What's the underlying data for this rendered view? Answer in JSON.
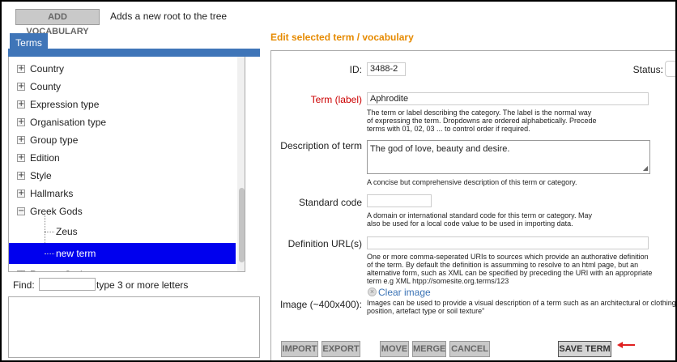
{
  "toolbar": {
    "add_vocab_label": "ADD VOCABULARY",
    "add_vocab_hint": "Adds a new root to the tree"
  },
  "tree": {
    "tab_label": "Terms",
    "items": [
      {
        "label": "Country",
        "toggle": "+"
      },
      {
        "label": "County",
        "toggle": "+"
      },
      {
        "label": "Expression type",
        "toggle": "+"
      },
      {
        "label": "Organisation type",
        "toggle": "+"
      },
      {
        "label": "Group type",
        "toggle": "+"
      },
      {
        "label": "Edition",
        "toggle": "+"
      },
      {
        "label": "Style",
        "toggle": "+"
      },
      {
        "label": "Hallmarks",
        "toggle": "+"
      },
      {
        "label": "Greek Gods",
        "toggle": "−"
      }
    ],
    "children": [
      "Zeus",
      "new term"
    ],
    "partial_next": "Roman Gods"
  },
  "find": {
    "label": "Find:",
    "value": "",
    "hint": "type 3 or more letters"
  },
  "form": {
    "title": "Edit selected term / vocabulary",
    "id_label": "ID:",
    "id_value": "3488-2",
    "status_label": "Status:",
    "term_label": "Term (label)",
    "term_value": "Aphrodite",
    "term_help": "The term or label describing the category. The label is the normal way of expressing the term. Dropdowns are ordered alphabetically. Precede terms with 01, 02, 03 ... to control order if required.",
    "desc_label": "Description of term",
    "desc_value": "The god of love, beauty and desire.",
    "desc_help": "A concise but comprehensive description of this term or category.",
    "code_label": "Standard code",
    "code_value": "",
    "code_help": "A domain or international standard code for this term or category. May also be used for a local code value to be used in importing data.",
    "url_label": "Definition URL(s)",
    "url_value": "",
    "url_help": "One or more comma-seperated URIs to sources which provide an authorative definition of the term. By default the definition is assumming to resolve to an html page, but an alternative form, such as XML can be specified by preceding the URI with an appropriate term e.g XML htpp://somesite.org.terms/123",
    "clear_image": "Clear image",
    "image_label": "Image (~400x400):",
    "image_help": "Images can be used to provide a visual description of a term such as an architectural or clothing position, artefact type or soil texture\""
  },
  "actions": {
    "import": "IMPORT",
    "export": "EXPORT",
    "move": "MOVE",
    "merge": "MERGE",
    "cancel": "CANCEL",
    "save": "SAVE TERM"
  },
  "colors": {
    "accent_orange": "#e68a00",
    "tab_blue": "#3f75b8",
    "selected_blue": "#0000ee",
    "required_red": "#cc0000",
    "arrow_red": "#e02020"
  }
}
